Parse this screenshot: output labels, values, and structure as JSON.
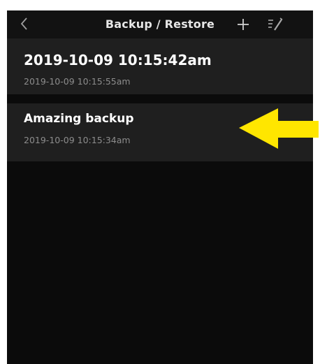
{
  "navbar": {
    "back_icon": "chevron-left-icon",
    "title": "Backup / Restore",
    "add_icon": "plus-icon",
    "edit_icon": "edit-list-icon"
  },
  "backups": [
    {
      "title": "2019-10-09 10:15:42am",
      "date": "2019-10-09 10:15:55am"
    },
    {
      "title": "Amazing backup",
      "date": "2019-10-09 10:15:34am"
    }
  ],
  "annotation": {
    "arrow_icon": "arrow-left-icon",
    "color": "#ffe600"
  },
  "colors": {
    "background": "#0b0b0b",
    "row_background": "#1f1f1f",
    "title_text": "#ffffff",
    "secondary_text": "#8c8c8c"
  }
}
